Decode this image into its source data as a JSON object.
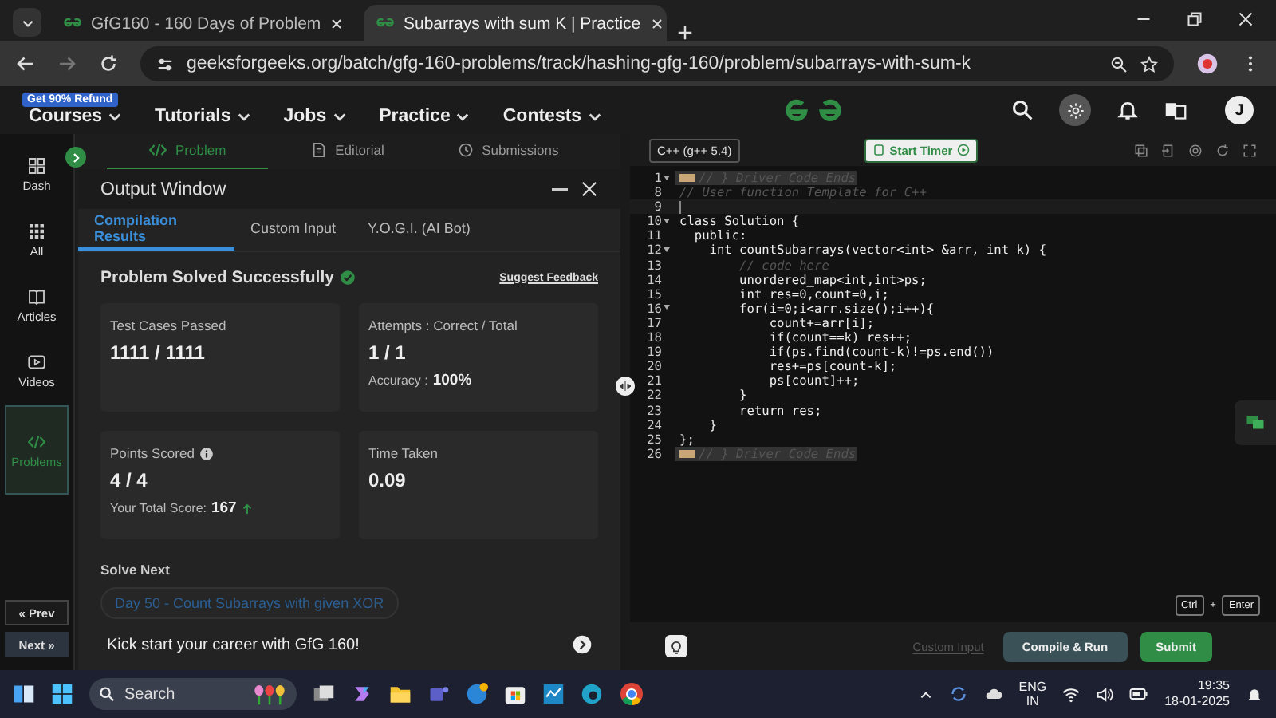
{
  "browser": {
    "tabs": [
      {
        "title": "GfG160 - 160 Days of Problem",
        "selected": false
      },
      {
        "title": "Subarrays with sum K | Practice",
        "selected": true
      }
    ],
    "url": "geeksforgeeks.org/batch/gfg-160-problems/track/hashing-gfg-160/problem/subarrays-with-sum-k"
  },
  "site_nav": {
    "badge": "Get 90% Refund",
    "menu": [
      "Courses",
      "Tutorials",
      "Jobs",
      "Practice",
      "Contests"
    ],
    "avatar": "J"
  },
  "sidebar": {
    "items": [
      {
        "label": "Dash",
        "selected": false
      },
      {
        "label": "All",
        "selected": false
      },
      {
        "label": "Articles",
        "selected": false
      },
      {
        "label": "Videos",
        "selected": false
      },
      {
        "label": "Problems",
        "selected": true
      }
    ],
    "prev": "« Prev",
    "next": "Next »"
  },
  "problem_tabs": [
    {
      "label": "Problem",
      "selected": true
    },
    {
      "label": "Editorial",
      "selected": false
    },
    {
      "label": "Submissions",
      "selected": false
    }
  ],
  "output_window": {
    "title": "Output Window",
    "tabs": [
      {
        "label": "Compilation Results",
        "selected": true
      },
      {
        "label": "Custom Input",
        "selected": false
      },
      {
        "label": "Y.O.G.I. (AI Bot)",
        "selected": false
      }
    ],
    "status": "Problem Solved Successfully",
    "feedback": "Suggest Feedback",
    "cards": [
      {
        "label": "Test Cases Passed",
        "value": "1111 / 1111",
        "info": false
      },
      {
        "label": "Attempts : Correct / Total",
        "value": "1 / 1",
        "info": false,
        "note_label": "Accuracy :",
        "note_value": "100%"
      },
      {
        "label": "Points Scored",
        "value": "4 / 4",
        "info": true,
        "note_label": "Your Total Score:",
        "note_value": "167"
      },
      {
        "label": "Time Taken",
        "value": "0.09",
        "info": false
      }
    ],
    "solve_next": {
      "heading": "Solve Next",
      "link": "Day 50 - Count Subarrays with given XOR"
    },
    "promo": "Kick start your career with GfG 160!"
  },
  "editor": {
    "language": "C++ (g++ 5.4)",
    "timer": "Start Timer",
    "lines": [
      {
        "number": "1",
        "kind": "folded",
        "foldable": true,
        "text": "// } Driver Code Ends"
      },
      {
        "number": "8",
        "kind": "comment",
        "foldable": false,
        "text": "// User function Template for C++"
      },
      {
        "number": "9",
        "kind": "cursor",
        "foldable": false
      },
      {
        "number": "10",
        "kind": "code",
        "foldable": true,
        "text": "class Solution {"
      },
      {
        "number": "11",
        "kind": "code",
        "foldable": false,
        "text": "  public:"
      },
      {
        "number": "12",
        "kind": "code",
        "foldable": true,
        "text": "    int countSubarrays(vector<int> &arr, int k) {"
      },
      {
        "number": "13",
        "kind": "comment",
        "foldable": false,
        "text": "        // code here"
      },
      {
        "number": "14",
        "kind": "code",
        "foldable": false,
        "text": "        unordered_map<int,int>ps;"
      },
      {
        "number": "15",
        "kind": "code",
        "foldable": false,
        "text": "        int res=0,count=0,i;"
      },
      {
        "number": "16",
        "kind": "code",
        "foldable": true,
        "text": "        for(i=0;i<arr.size();i++){"
      },
      {
        "number": "17",
        "kind": "code",
        "foldable": false,
        "text": "            count+=arr[i];"
      },
      {
        "number": "18",
        "kind": "code",
        "foldable": false,
        "text": "            if(count==k) res++;"
      },
      {
        "number": "19",
        "kind": "code",
        "foldable": false,
        "text": "            if(ps.find(count-k)!=ps.end())"
      },
      {
        "number": "20",
        "kind": "code",
        "foldable": false,
        "text": "            res+=ps[count-k];"
      },
      {
        "number": "21",
        "kind": "code",
        "foldable": false,
        "text": "            ps[count]++;"
      },
      {
        "number": "22",
        "kind": "code",
        "foldable": false,
        "text": "        }"
      },
      {
        "number": "23",
        "kind": "code",
        "foldable": false,
        "text": "        return res;"
      },
      {
        "number": "24",
        "kind": "code",
        "foldable": false,
        "text": "    }"
      },
      {
        "number": "25",
        "kind": "code",
        "foldable": false,
        "text": "};"
      },
      {
        "number": "26",
        "kind": "folded",
        "foldable": false,
        "text": "// } Driver Code Ends"
      }
    ],
    "shortcut": {
      "key1": "Ctrl",
      "joiner": "+",
      "key2": "Enter"
    },
    "custom_input": "Custom Input",
    "compile": "Compile & Run",
    "submit": "Submit"
  },
  "taskbar": {
    "search": "Search",
    "language": "ENG",
    "region": "IN",
    "time": "19:35",
    "date": "18-01-2025"
  }
}
